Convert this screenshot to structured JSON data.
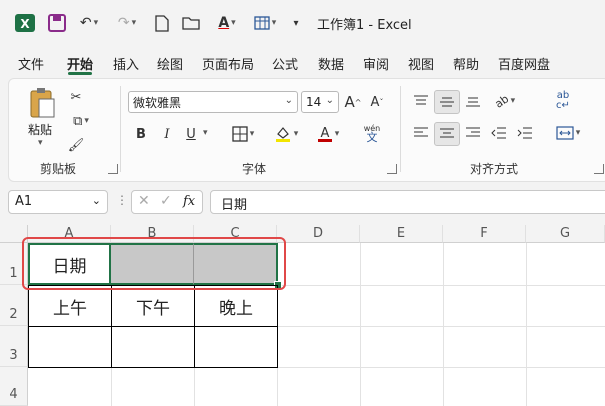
{
  "app": {
    "title": "工作簿1 - Excel"
  },
  "tabs": [
    "文件",
    "开始",
    "插入",
    "绘图",
    "页面布局",
    "公式",
    "数据",
    "审阅",
    "视图",
    "帮助",
    "百度网盘"
  ],
  "active_tab": "开始",
  "ribbon": {
    "clipboard": {
      "label": "剪贴板",
      "paste_label": "粘贴"
    },
    "font": {
      "label": "字体",
      "name": "微软雅黑",
      "size": "14",
      "phonetic": "wén",
      "bold": "B",
      "italic": "I",
      "underline": "U",
      "grow": "A",
      "shrink": "A"
    },
    "alignment": {
      "label": "对齐方式"
    }
  },
  "formula_bar": {
    "name_box": "A1",
    "fx": "fx",
    "value": "日期"
  },
  "columns": [
    "A",
    "B",
    "C",
    "D",
    "E",
    "F",
    "G"
  ],
  "rows": [
    "1",
    "2",
    "3",
    "4"
  ],
  "cells": {
    "A1": "日期",
    "A2": "上午",
    "B2": "下午",
    "C2": "晚上"
  },
  "colors": {
    "accent": "#217346",
    "highlight_box": "#e04848",
    "merged_fill": "#c8c8c8",
    "cell_border": "#000000"
  }
}
